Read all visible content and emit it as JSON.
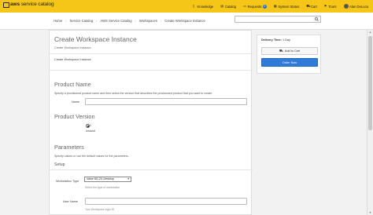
{
  "brand": {
    "name_bold": "aws",
    "name_rest": " service catalog"
  },
  "nav": [
    {
      "label": "Knowledge",
      "icon": "book-icon"
    },
    {
      "label": "Catalog",
      "icon": "catalog-icon"
    },
    {
      "label": "Requests",
      "icon": "requests-icon",
      "badge": "0"
    },
    {
      "label": "System Status",
      "icon": "status-icon"
    },
    {
      "label": "Cart",
      "icon": "cart-icon"
    },
    {
      "label": "Tours",
      "icon": "tours-icon"
    },
    {
      "label": "Alan DeLuca",
      "icon": "avatar"
    }
  ],
  "breadcrumb": [
    "Home",
    "Service Catalog",
    "AWS Service Catalog",
    "Workspaces",
    "Create Workspace Instance"
  ],
  "search": {
    "placeholder": ""
  },
  "main": {
    "title": "Create Workspace Instance",
    "subtitle": "Create Workspace instance",
    "subtitle2": "Create Workspace Instance",
    "product_name": {
      "heading": "Product Name",
      "desc": "Specify a provisioned product name and then select the version that describes the provisioned product that you want to create.",
      "name_label": "Name",
      "name_value": ""
    },
    "product_version": {
      "heading": "Product Version",
      "option_value": "1",
      "option_label": "Instand"
    },
    "parameters": {
      "heading": "Parameters",
      "desc": "Specify values or use the default values for the parameters.",
      "setup_heading": "Setup",
      "workstation_label": "Workstation Type",
      "workstation_value": "Value 8G-2X-Desktop",
      "workstation_help": "Select the type of workstation",
      "username_label": "User Name",
      "username_value": "",
      "username_help": "Your Workspace login ID"
    }
  },
  "sidebar": {
    "delivery_label": "Delivery Time:",
    "delivery_value": "1 Day",
    "add_to_cart": "Add to Cart",
    "order_now": "Order Now"
  }
}
